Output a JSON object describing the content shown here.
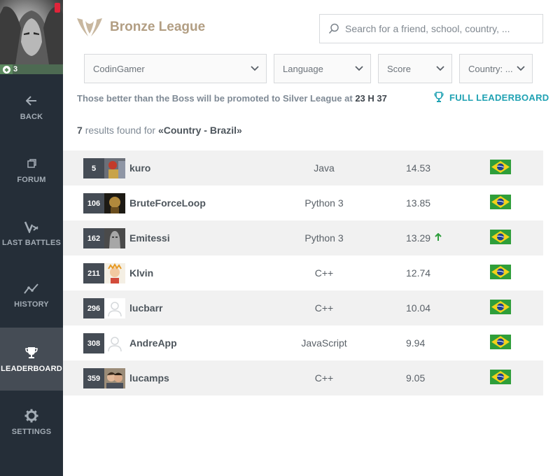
{
  "sidebar": {
    "level": "3",
    "items": [
      {
        "label": "BACK",
        "icon": "arrow-left-icon"
      },
      {
        "label": "FORUM",
        "icon": "forum-icon"
      },
      {
        "label": "LAST BATTLES",
        "icon": "battles-icon"
      },
      {
        "label": "HISTORY",
        "icon": "history-chart-icon"
      },
      {
        "label": "LEADERBOARD",
        "icon": "trophy-icon",
        "active": true
      },
      {
        "label": "SETTINGS",
        "icon": "gear-icon"
      }
    ]
  },
  "header": {
    "league_title": "Bronze League",
    "search_placeholder": "Search for a friend, school, country, ..."
  },
  "filters": {
    "codingamer": "CodinGamer",
    "language": "Language",
    "score": "Score",
    "country": "Country: ..."
  },
  "promo": {
    "text": "Those better than the Boss will be promoted to Silver League at",
    "time": "23 H 37",
    "full_leaderboard": "FULL LEADERBOARD"
  },
  "results": {
    "count": "7",
    "label": "results found for",
    "query": "«Country - Brazil»"
  },
  "colors": {
    "sidebar": "#252e38",
    "sidebar_active": "#454c55",
    "league": "#b29e83",
    "accent": "#20a2b3",
    "up_arrow": "#2e9e3c",
    "battle_icon": "#e0243a"
  },
  "rows": [
    {
      "rank": "5",
      "name": "kuro",
      "language": "Java",
      "score": "14.53",
      "country": "Brazil"
    },
    {
      "rank": "106",
      "name": "BruteForceLoop",
      "language": "Python 3",
      "score": "13.85",
      "country": "Brazil"
    },
    {
      "rank": "162",
      "name": "Emitessi",
      "language": "Python 3",
      "score": "13.29",
      "country": "Brazil",
      "in_battle": true,
      "trend": "up"
    },
    {
      "rank": "211",
      "name": "Klvin",
      "language": "C++",
      "score": "12.74",
      "country": "Brazil"
    },
    {
      "rank": "296",
      "name": "lucbarr",
      "language": "C++",
      "score": "10.04",
      "country": "Brazil"
    },
    {
      "rank": "308",
      "name": "AndreApp",
      "language": "JavaScript",
      "score": "9.94",
      "country": "Brazil"
    },
    {
      "rank": "359",
      "name": "lucamps",
      "language": "C++",
      "score": "9.05",
      "country": "Brazil"
    }
  ]
}
